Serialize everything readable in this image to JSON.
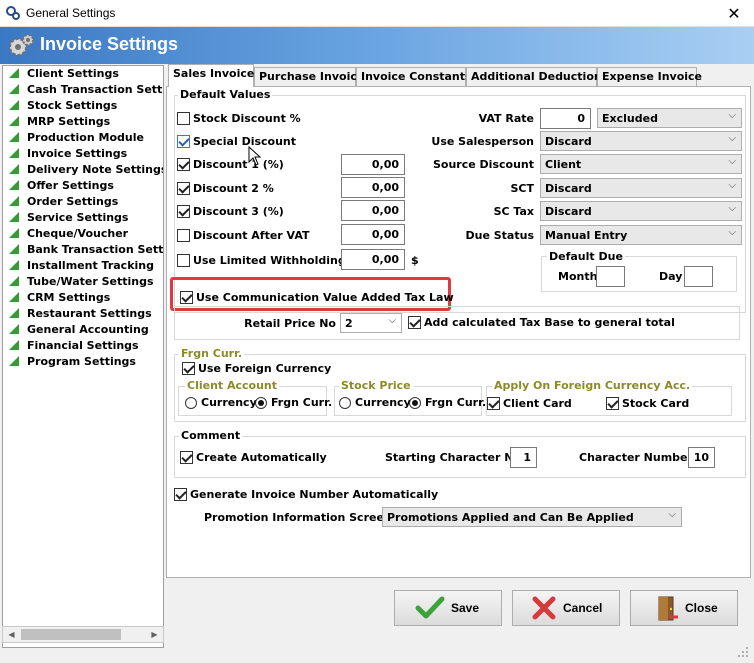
{
  "window": {
    "title": "General Settings",
    "header_title": "Invoice Settings",
    "close_glyph": "✕"
  },
  "sidebar": {
    "items": [
      "Client Settings",
      "Cash Transaction Settings",
      "Stock Settings",
      "MRP Settings",
      "Production Module",
      "Invoice Settings",
      "Delivery Note Settings",
      "Offer Settings",
      "Order Settings",
      "Service Settings",
      "Cheque/Voucher",
      "Bank Transaction Settings",
      "Installment Tracking",
      "Tube/Water Settings",
      "CRM Settings",
      "Restaurant Settings",
      "General Accounting",
      "Financial Settings",
      "Program Settings"
    ]
  },
  "tabs": {
    "sales_invoice": "Sales Invoice",
    "purchase_invoice": "Purchase Invoice",
    "invoice_constants": "Invoice Constants",
    "additional_deductions": "Additional Deductions",
    "expense_invoice": "Expense Invoice"
  },
  "default_values": {
    "title": "Default Values",
    "stock_discount_label": "Stock Discount %",
    "special_discount_label": "Special Discount",
    "discount1_label": "Discount 1 (%)",
    "discount1_value": "0,00",
    "discount2_label": "Discount 2 %",
    "discount2_value": "0,00",
    "discount3_label": "Discount 3 (%)",
    "discount3_value": "0,00",
    "discount_after_vat_label": "Discount After VAT",
    "discount_after_vat_value": "0,00",
    "limited_withholding_label": "Use Limited Withholding",
    "limited_withholding_value": "0,00",
    "currency_symbol": "$",
    "vat_rate_label": "VAT Rate",
    "vat_rate_value": "0",
    "vat_mode": "Excluded",
    "use_salesperson_label": "Use Salesperson",
    "use_salesperson_value": "Discard",
    "source_discount_label": "Source Discount",
    "source_discount_value": "Client",
    "sct_label": "SCT",
    "sct_value": "Discard",
    "sc_tax_label": "SC Tax",
    "sc_tax_value": "Discard",
    "due_status_label": "Due Status",
    "due_status_value": "Manual Entry",
    "default_due_title": "Default Due",
    "month_label": "Month",
    "day_label": "Day"
  },
  "communication_vat_label": "Use Communication Value Added Tax Law",
  "retail_price_no_label": "Retail Price No",
  "retail_price_no_value": "2",
  "add_calc_tax_label": "Add calculated Tax Base to general total",
  "foreign_currency": {
    "title": "Frgn Curr.",
    "use_foreign_label": "Use Foreign Currency",
    "client_account_title": "Client Account",
    "stock_price_title": "Stock Price",
    "apply_on_title": "Apply On Foreign Currency Acc.",
    "currency_option": "Currency",
    "frgn_curr_option": "Frgn Curr.",
    "client_card_label": "Client Card",
    "stock_card_label": "Stock Card"
  },
  "comment": {
    "title": "Comment",
    "create_auto_label": "Create Automatically",
    "starting_char_label": "Starting Character No",
    "starting_char_value": "1",
    "char_number_label": "Character Number",
    "char_number_value": "10"
  },
  "generate_invoice_number_label": "Generate Invoice Number Automatically",
  "promotion_info_label": "Promotion Information Screen",
  "promotion_info_value": "Promotions Applied and Can Be Applied",
  "buttons": {
    "save": "Save",
    "cancel": "Cancel",
    "close": "Close"
  },
  "colors": {
    "header_start": "#3b78c3",
    "header_end": "#a9cff3",
    "highlight": "#e0393f",
    "group_title_olive": "#8b8b2a",
    "sidebar_triangle": "#3a9a3a",
    "save_check": "#3ca33c",
    "cancel_x": "#d63a3a"
  }
}
